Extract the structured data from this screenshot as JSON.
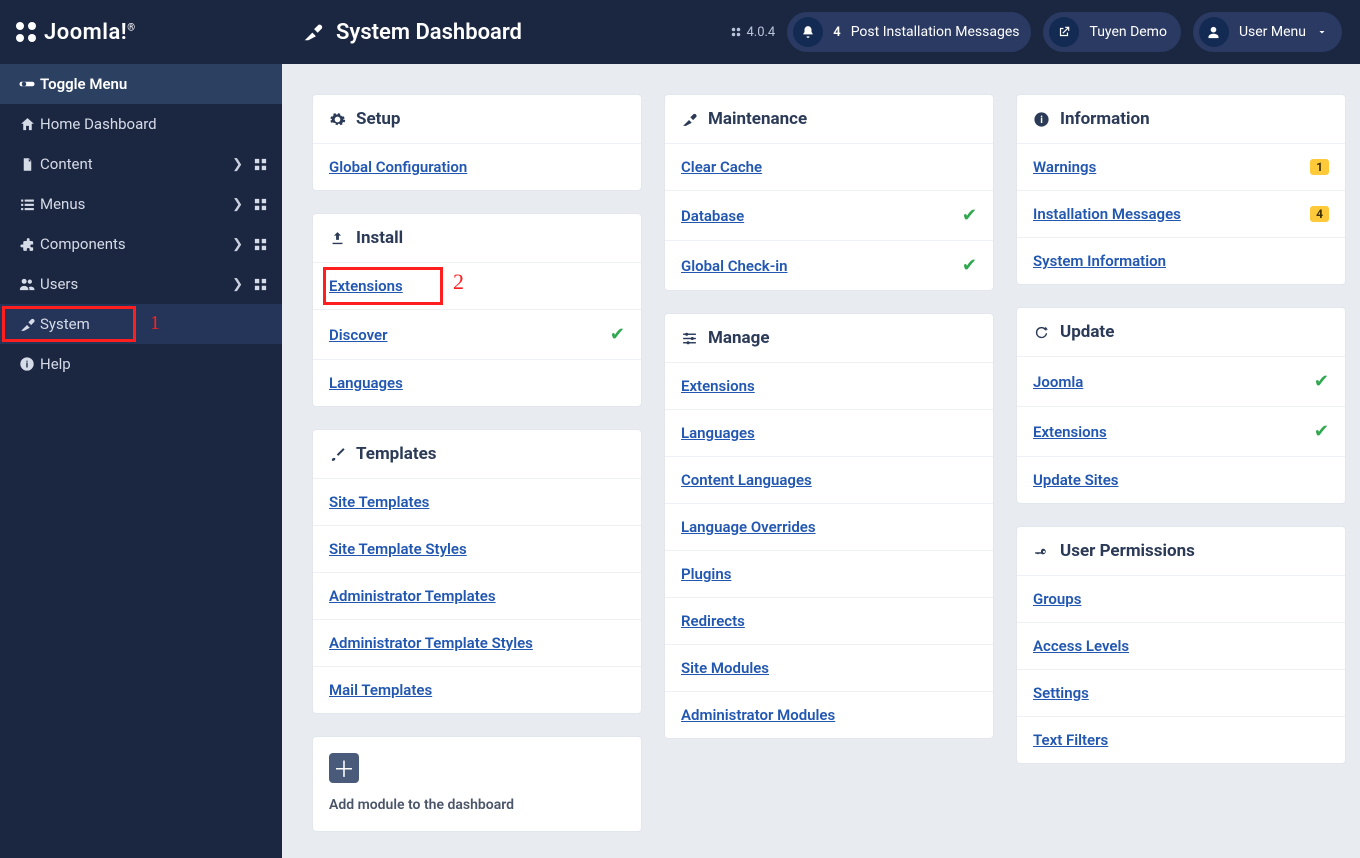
{
  "brand": {
    "name": "Joomla!",
    "mark_sup": "®"
  },
  "header": {
    "title": "System Dashboard",
    "version": "4.0.4",
    "notif_count": "4",
    "notif_label": "Post Installation Messages",
    "site_label": "Tuyen Demo",
    "user_label": "User Menu"
  },
  "sidebar": {
    "toggle": "Toggle Menu",
    "items": [
      {
        "label": "Home Dashboard",
        "icon": "home",
        "has_sub": false
      },
      {
        "label": "Content",
        "icon": "file",
        "has_sub": true
      },
      {
        "label": "Menus",
        "icon": "list",
        "has_sub": true
      },
      {
        "label": "Components",
        "icon": "puzzle",
        "has_sub": true
      },
      {
        "label": "Users",
        "icon": "users",
        "has_sub": true
      },
      {
        "label": "System",
        "icon": "wrench",
        "has_sub": false,
        "active": true,
        "marker": "1"
      },
      {
        "label": "Help",
        "icon": "info",
        "has_sub": false
      }
    ]
  },
  "cards": {
    "setup": {
      "title": "Setup",
      "items": [
        {
          "label": "Global Configuration"
        }
      ]
    },
    "install": {
      "title": "Install",
      "items": [
        {
          "label": "Extensions",
          "marker": "2"
        },
        {
          "label": "Discover",
          "check": true
        },
        {
          "label": "Languages"
        }
      ]
    },
    "templates": {
      "title": "Templates",
      "items": [
        {
          "label": "Site Templates"
        },
        {
          "label": "Site Template Styles"
        },
        {
          "label": "Administrator Templates"
        },
        {
          "label": "Administrator Template Styles"
        },
        {
          "label": "Mail Templates"
        }
      ]
    },
    "maintenance": {
      "title": "Maintenance",
      "items": [
        {
          "label": "Clear Cache"
        },
        {
          "label": "Database",
          "check": true
        },
        {
          "label": "Global Check-in",
          "check": true
        }
      ]
    },
    "manage": {
      "title": "Manage",
      "items": [
        {
          "label": "Extensions"
        },
        {
          "label": "Languages"
        },
        {
          "label": "Content Languages"
        },
        {
          "label": "Language Overrides"
        },
        {
          "label": "Plugins"
        },
        {
          "label": "Redirects"
        },
        {
          "label": "Site Modules"
        },
        {
          "label": "Administrator Modules"
        }
      ]
    },
    "information": {
      "title": "Information",
      "items": [
        {
          "label": "Warnings",
          "badge": "1"
        },
        {
          "label": "Installation Messages",
          "badge": "4"
        },
        {
          "label": "System Information"
        }
      ]
    },
    "update": {
      "title": "Update",
      "items": [
        {
          "label": "Joomla",
          "check": true
        },
        {
          "label": "Extensions",
          "check": true
        },
        {
          "label": "Update Sites"
        }
      ]
    },
    "permissions": {
      "title": "User Permissions",
      "items": [
        {
          "label": "Groups"
        },
        {
          "label": "Access Levels"
        },
        {
          "label": "Settings"
        },
        {
          "label": "Text Filters"
        }
      ]
    }
  },
  "add_module": "Add module to the dashboard"
}
